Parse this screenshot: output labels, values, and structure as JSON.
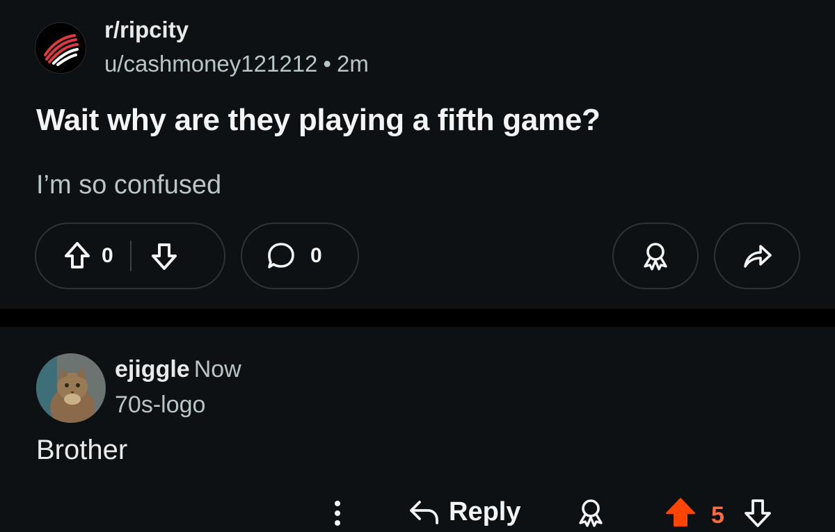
{
  "post": {
    "subreddit": "r/ripcity",
    "author": "u/cashmoney121212",
    "separator": "•",
    "time": "2m",
    "title": "Wait why are they playing a fifth game?",
    "body": "I’m so confused",
    "score": "0",
    "comment_count": "0",
    "icons": [
      "upvote-icon",
      "downvote-icon",
      "comment-bubble-icon",
      "award-icon",
      "share-icon"
    ]
  },
  "comment": {
    "username": "ejiggle",
    "time": "Now",
    "flair": "70s-logo",
    "body": "Brother",
    "reply_label": "Reply",
    "score": "5",
    "icons": [
      "more-vertical-icon",
      "reply-arrow-icon",
      "award-icon",
      "upvote-filled-icon",
      "downvote-icon"
    ]
  },
  "colors": {
    "background": "#0e1113",
    "divider": "#000000",
    "text_primary": "#f2f4f5",
    "text_secondary": "#b8c5c9",
    "border": "#2f3336",
    "upvote_active": "#ff4500",
    "score_active": "#ff6a3d",
    "brand_red": "#e03a3e"
  }
}
